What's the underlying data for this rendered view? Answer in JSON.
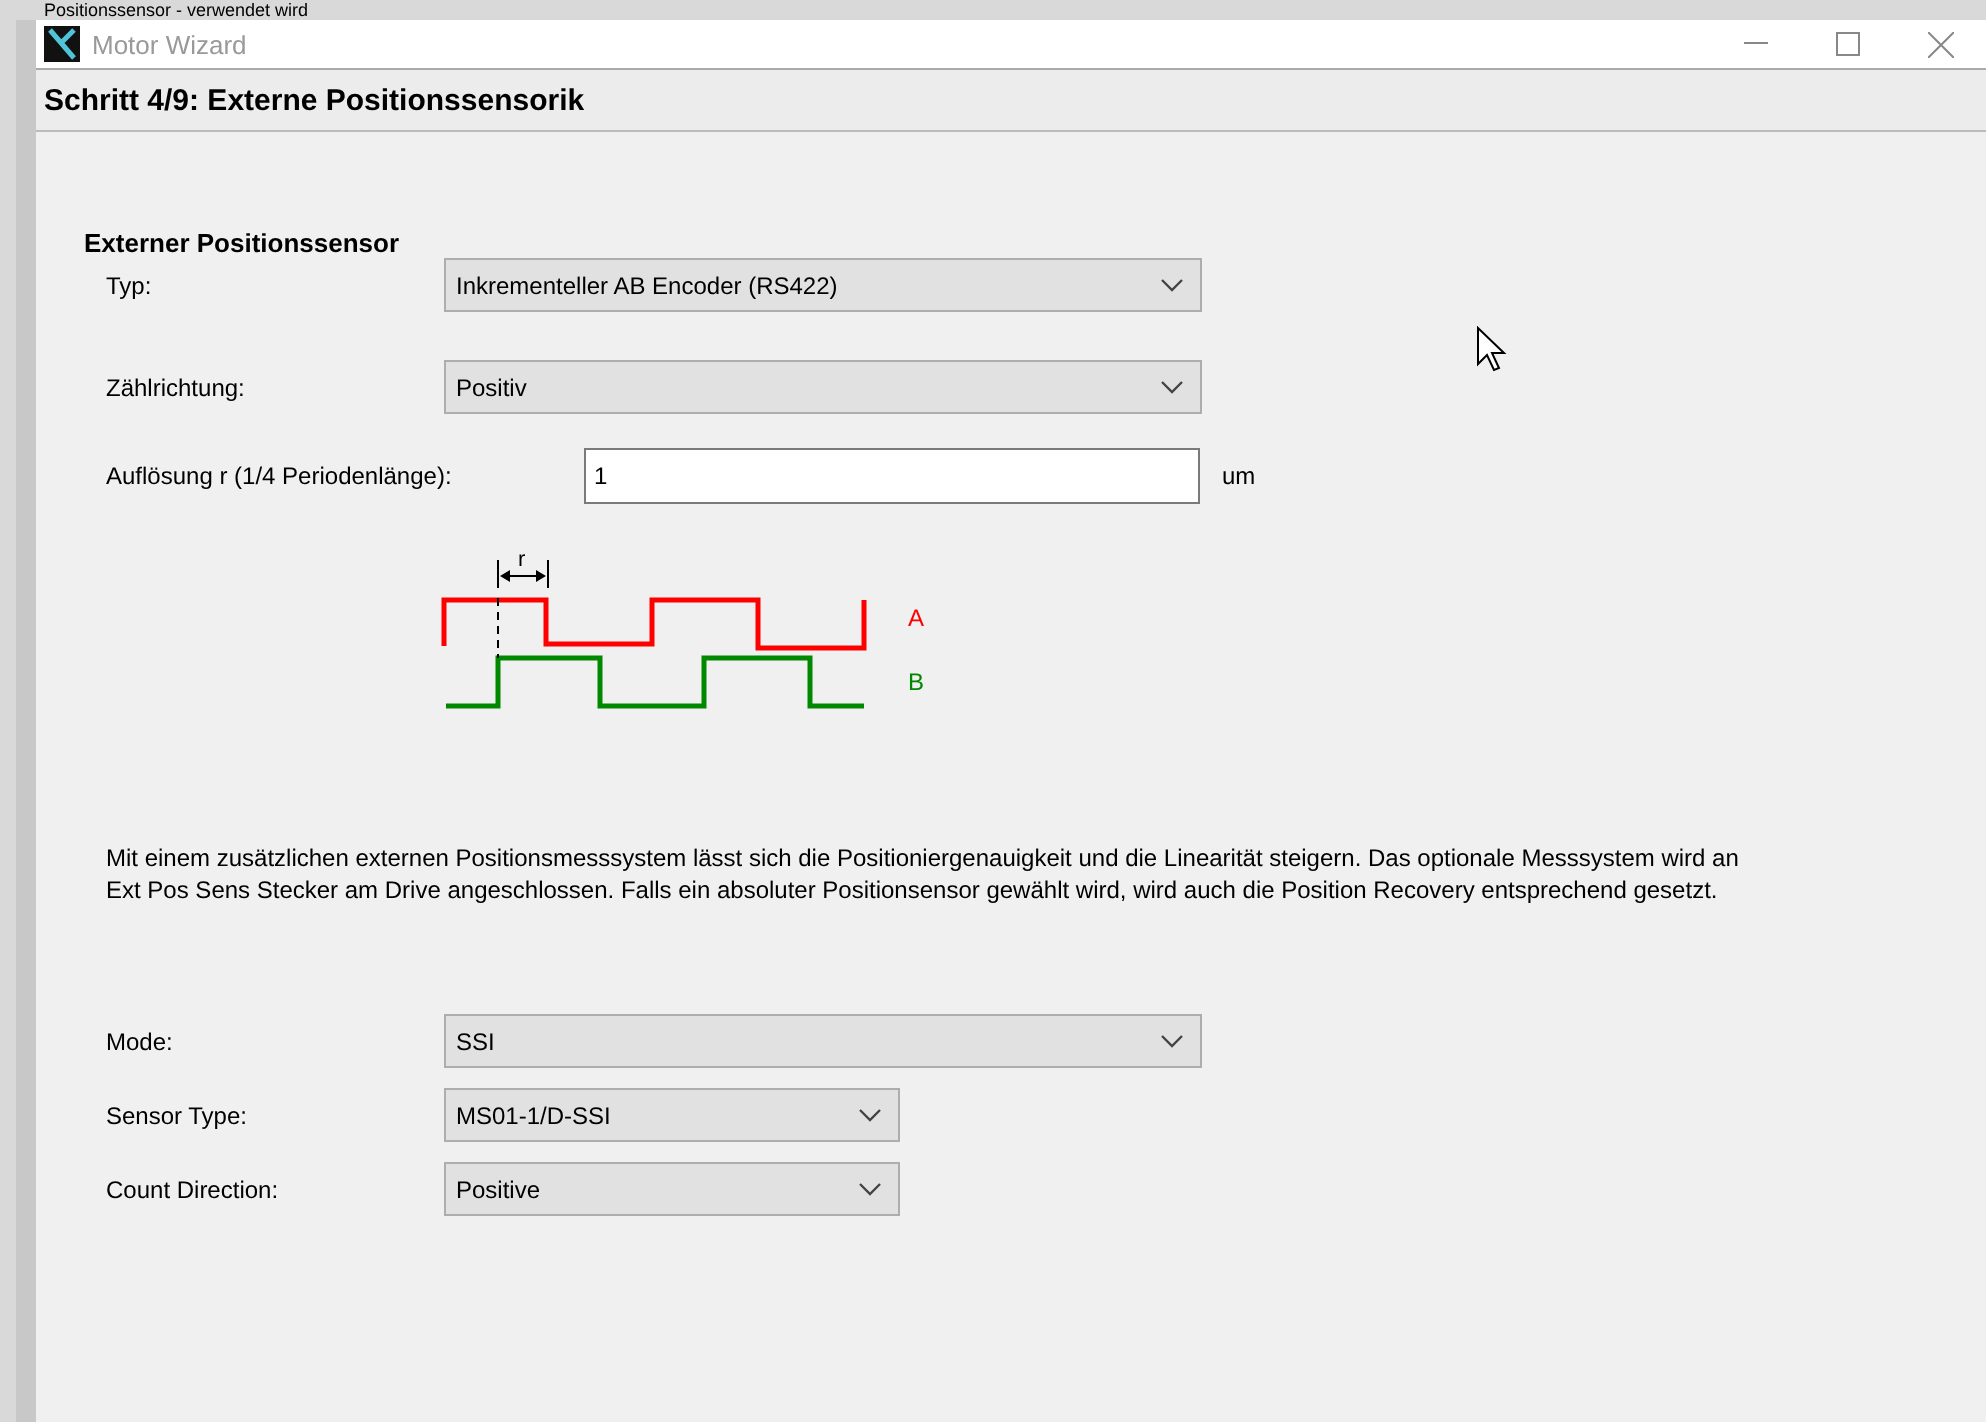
{
  "top_strip": {
    "text": "Positionssensor - verwendet wird"
  },
  "window": {
    "title": "Motor Wizard"
  },
  "step_header": {
    "title": "Schritt 4/9: Externe Positionssensorik"
  },
  "section_title": "Externer Positionssensor",
  "fields": [
    {
      "kind": "dropdown",
      "label": "Typ:",
      "value": "Inkrementeller AB Encoder (RS422)"
    },
    {
      "kind": "dropdown",
      "label": "Zählrichtung:",
      "value": "Positiv"
    },
    {
      "kind": "input",
      "label": "Auflösung r (1/4 Periodenlänge):",
      "value": "1",
      "unit": "um"
    }
  ],
  "diagram": {
    "measure_label": "r",
    "signal_a": "A",
    "signal_b": "B"
  },
  "description": "Mit einem zusätzlichen externen Positionsmesssystem lässt sich die Positioniergenauigkeit und die Linearität steigern. Das optionale Messsystem wird an Ext Pos Sens Stecker am Drive angeschlossen. Falls ein absoluter Positionsensor gewählt wird, wird auch die Position Recovery entsprechend gesetzt.",
  "sensor_fields": [
    {
      "kind": "wide",
      "label": "Mode:",
      "value": "SSI"
    },
    {
      "kind": "narrow",
      "label": "Sensor Type:",
      "value": "MS01-1/D-SSI"
    },
    {
      "kind": "narrow",
      "label": "Count Direction:",
      "value": "Positive"
    }
  ]
}
